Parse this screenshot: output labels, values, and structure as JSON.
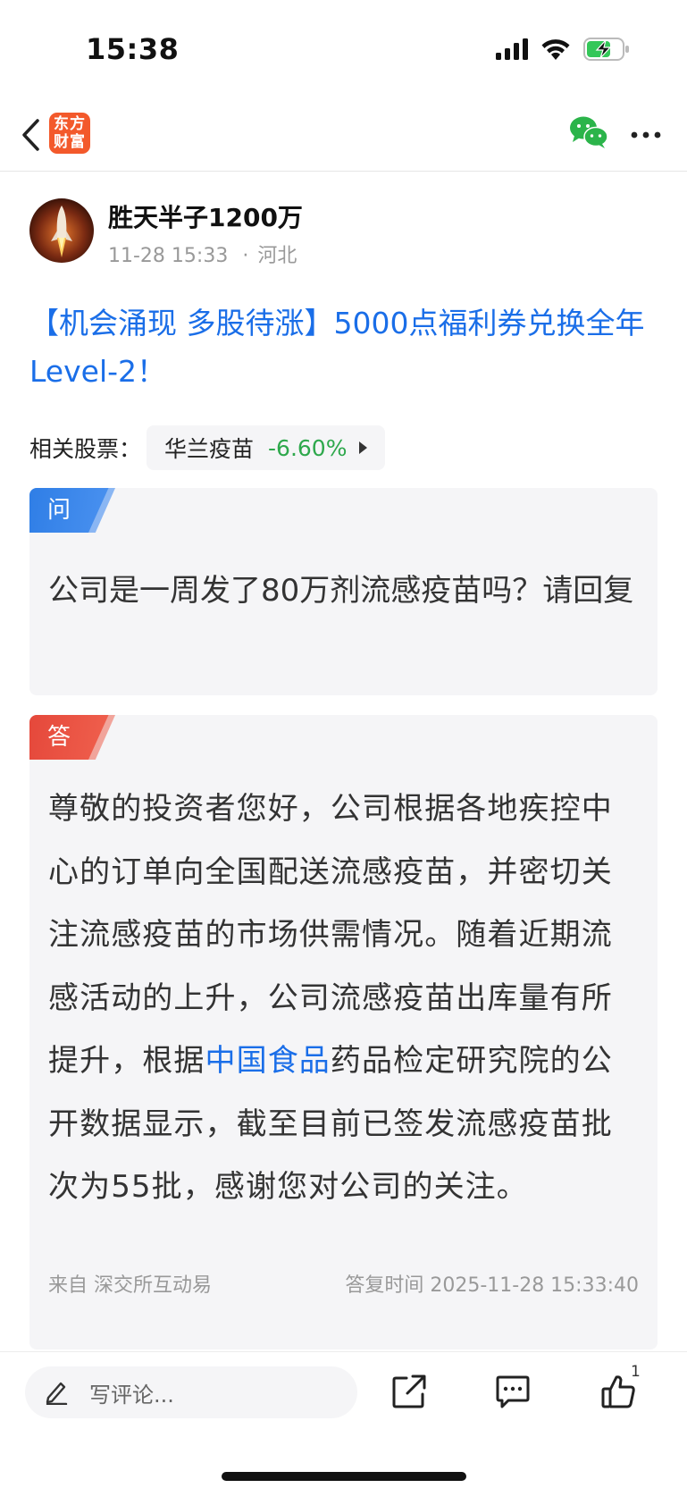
{
  "status_bar": {
    "time": "15:38"
  },
  "nav": {
    "logo_text_line1": "东方",
    "logo_text_line2": "财富",
    "brand_color": "#f3592b"
  },
  "author": {
    "name": "胜天半子1200万",
    "time": "11-28 15:33",
    "separator": "·",
    "location": "河北"
  },
  "post": {
    "title": "【机会涌现 多股待涨】5000点福利券兑换全年Level-2！",
    "link_color": "#1a6ee8"
  },
  "related_stock": {
    "label": "相关股票：",
    "name": "华兰疫苗",
    "change": "-6.60%",
    "change_color": "#2ea84c"
  },
  "question": {
    "tag": "问",
    "text": "公司是一周发了80万剂流感疫苗吗？请回复"
  },
  "answer": {
    "tag": "答",
    "text_before_link": "尊敬的投资者您好，公司根据各地疾控中心的订单向全国配送流感疫苗，并密切关注流感疫苗的市场供需情况。随着近期流感活动的上升，公司流感疫苗出库量有所提升，根据",
    "link_text": "中国食品",
    "text_after_link": "药品检定研究院的公开数据显示，截至目前已签发流感疫苗批次为55批，感谢您对公司的关注。",
    "source": "来自 深交所互动易",
    "reply_time": "答复时间 2025-11-28 15:33:40"
  },
  "bottom_bar": {
    "comment_placeholder": "写评论...",
    "like_count": "1"
  },
  "icons": {
    "back": "chevron-left-icon",
    "wechat": "wechat-icon",
    "more": "more-dots-icon",
    "edit": "pencil-icon",
    "share": "share-icon",
    "comment": "comment-icon",
    "like": "thumbs-up-icon"
  }
}
